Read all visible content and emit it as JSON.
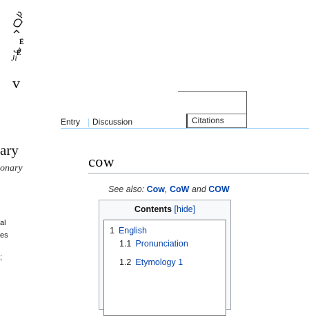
{
  "sidebar": {
    "wordmark": "ary",
    "tagline": "onary",
    "fragments": [
      "al",
      "es",
      ";"
    ]
  },
  "tabs": {
    "entry": "Entry",
    "discussion": "Discussion",
    "citations": "Citations"
  },
  "page": {
    "title": "cow"
  },
  "hatnote": {
    "prefix": "See also:",
    "link1": "Cow",
    "link2": "CoW",
    "conjunction": "and",
    "link3": "COW"
  },
  "toc": {
    "title": "Contents",
    "hide_label": "[hide]",
    "items": [
      {
        "number": "1",
        "label": "English"
      },
      {
        "number": "1.1",
        "label": "Pronunciation"
      },
      {
        "number": "1.2",
        "label": "Etymology 1"
      }
    ]
  },
  "colors": {
    "link": "#0645ad",
    "tab_border": "#a7d7f9",
    "toc_background": "#f8f9fa"
  }
}
